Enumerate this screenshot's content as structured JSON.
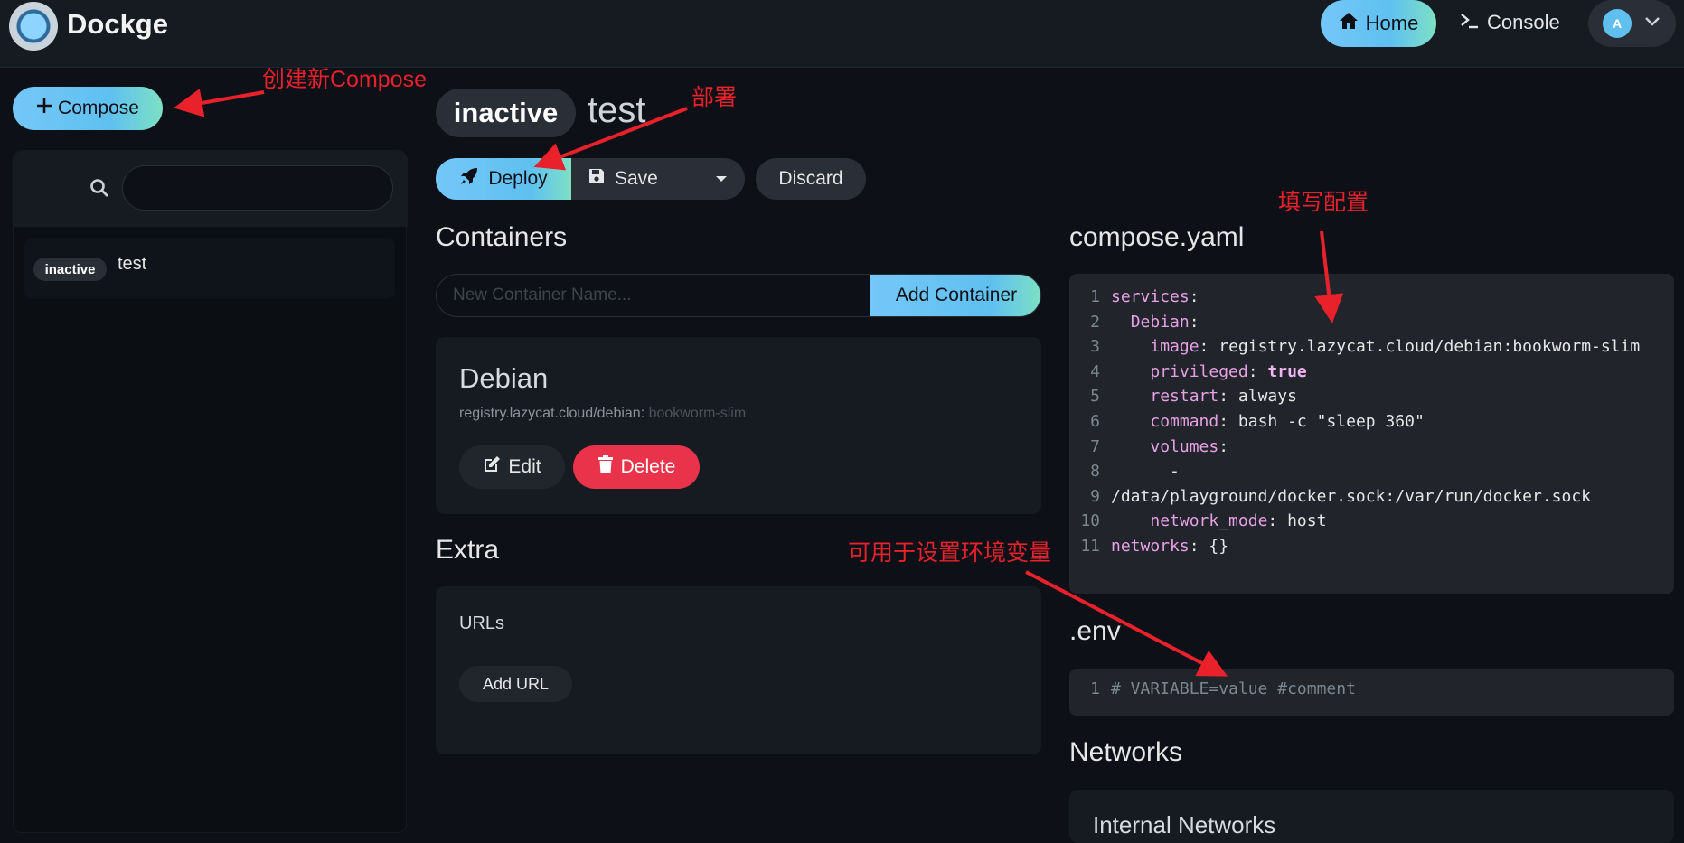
{
  "header": {
    "brand": "Dockge",
    "nav_home": "Home",
    "nav_console": "Console",
    "avatar_letter": "A"
  },
  "sidebar": {
    "compose_button": "Compose",
    "search_value": "",
    "stacks": [
      {
        "status": "inactive",
        "name": "test"
      }
    ]
  },
  "stack": {
    "status": "inactive",
    "name": "test",
    "deploy_label": "Deploy",
    "save_label": "Save",
    "discard_label": "Discard"
  },
  "containers": {
    "heading": "Containers",
    "new_container_placeholder": "New Container Name...",
    "add_container_label": "Add Container",
    "items": [
      {
        "name": "Debian",
        "image_repo": "registry.lazycat.cloud/debian:",
        "image_tag": "bookworm-slim",
        "edit_label": "Edit",
        "delete_label": "Delete"
      }
    ]
  },
  "extra": {
    "heading": "Extra",
    "urls_label": "URLs",
    "add_url_label": "Add URL"
  },
  "compose_yaml": {
    "heading": "compose.yaml",
    "lines": [
      {
        "n": "1",
        "indent": "",
        "key": "services",
        "sep": ":",
        "value": ""
      },
      {
        "n": "2",
        "indent": "  ",
        "key": "Debian",
        "sep": ":",
        "value": ""
      },
      {
        "n": "3",
        "indent": "    ",
        "key": "image",
        "sep": ": ",
        "value": "registry.lazycat.cloud/debian:bookworm-slim"
      },
      {
        "n": "4",
        "indent": "    ",
        "key": "privileged",
        "sep": ": ",
        "value": "true",
        "bool": true
      },
      {
        "n": "5",
        "indent": "    ",
        "key": "restart",
        "sep": ": ",
        "value": "always"
      },
      {
        "n": "6",
        "indent": "    ",
        "key": "command",
        "sep": ": ",
        "value": "bash -c \"sleep 360\""
      },
      {
        "n": "7",
        "indent": "    ",
        "key": "volumes",
        "sep": ":",
        "value": ""
      },
      {
        "n": "8",
        "indent": "      ",
        "key": "",
        "sep": "",
        "value": "-"
      },
      {
        "n": "9",
        "indent": "",
        "key": "",
        "sep": "",
        "value": "/data/playground/docker.sock:/var/run/docker.sock"
      },
      {
        "n": "10",
        "indent": "    ",
        "key": "network_mode",
        "sep": ": ",
        "value": "host"
      },
      {
        "n": "11",
        "indent": "",
        "key": "networks",
        "sep": ": ",
        "value": "{}"
      }
    ]
  },
  "env": {
    "heading": ".env",
    "line_number": "1",
    "content": "# VARIABLE=value #comment"
  },
  "networks": {
    "heading": "Networks",
    "internal_label": "Internal Networks"
  },
  "annotations": {
    "create_compose": "创建新Compose",
    "deploy": "部署",
    "fill_config": "填写配置",
    "env_usage": "可用于设置环境变量",
    "color": "#e8212b"
  },
  "colors": {
    "accent": "#5fc0f0",
    "danger": "#e8334a",
    "background": "#0d1117"
  }
}
